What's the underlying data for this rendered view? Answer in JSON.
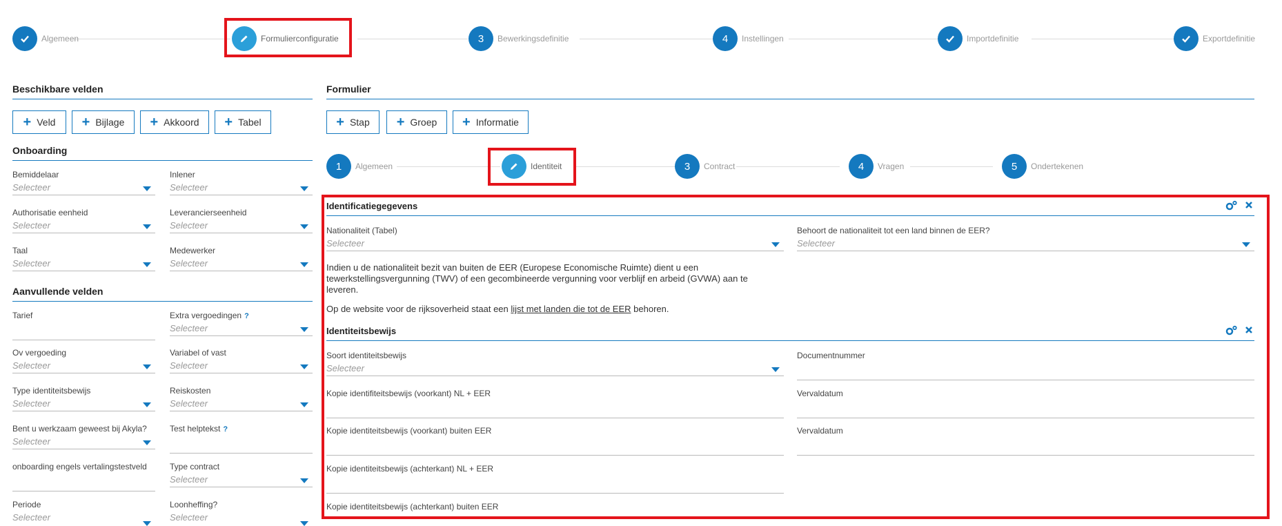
{
  "stepper": [
    {
      "number": "",
      "label": "Algemeen",
      "state": "done"
    },
    {
      "number": "",
      "label": "Formulierconfiguratie",
      "state": "active"
    },
    {
      "number": "3",
      "label": "Bewerkingsdefinitie",
      "state": "todo"
    },
    {
      "number": "4",
      "label": "Instellingen",
      "state": "todo"
    },
    {
      "number": "",
      "label": "Importdefinitie",
      "state": "done"
    },
    {
      "number": "",
      "label": "Exportdefinitie",
      "state": "done"
    }
  ],
  "left": {
    "title": "Beschikbare velden",
    "buttons": [
      "Veld",
      "Bijlage",
      "Akkoord",
      "Tabel"
    ],
    "onboarding_title": "Onboarding",
    "onboarding_fields": [
      {
        "label": "Bemiddelaar",
        "value": "Selecteer"
      },
      {
        "label": "Inlener",
        "value": "Selecteer"
      },
      {
        "label": "Authorisatie eenheid",
        "value": "Selecteer"
      },
      {
        "label": "Leverancierseenheid",
        "value": "Selecteer"
      },
      {
        "label": "Taal",
        "value": "Selecteer"
      },
      {
        "label": "Medewerker",
        "value": "Selecteer"
      }
    ],
    "extra_title": "Aanvullende velden",
    "extra_fields": [
      {
        "label": "Tarief",
        "value": ""
      },
      {
        "label": "Extra vergoedingen",
        "value": "Selecteer",
        "help": "?"
      },
      {
        "label": "Ov vergoeding",
        "value": "Selecteer"
      },
      {
        "label": "Variabel of vast",
        "value": "Selecteer"
      },
      {
        "label": "Type identiteitsbewijs",
        "value": "Selecteer"
      },
      {
        "label": "Reiskosten",
        "value": "Selecteer"
      },
      {
        "label": "Bent u werkzaam geweest bij Akyla?",
        "value": "Selecteer"
      },
      {
        "label": "Test helptekst",
        "value": "",
        "help": "?"
      },
      {
        "label": "onboarding engels vertalingstestveld",
        "value": ""
      },
      {
        "label": "Type contract",
        "value": "Selecteer"
      },
      {
        "label": "Periode",
        "value": "Selecteer"
      },
      {
        "label": "Loonheffing?",
        "value": "Selecteer"
      }
    ]
  },
  "right": {
    "title": "Formulier",
    "buttons": [
      "Stap",
      "Groep",
      "Informatie"
    ],
    "form_steps": [
      {
        "number": "1",
        "label": "Algemeen"
      },
      {
        "number": "",
        "label": "Identiteit"
      },
      {
        "number": "3",
        "label": "Contract"
      },
      {
        "number": "4",
        "label": "Vragen"
      },
      {
        "number": "5",
        "label": "Ondertekenen"
      }
    ],
    "group1": {
      "title": "Identificatiegegevens",
      "fields": [
        {
          "label": "Nationaliteit (Tabel)",
          "value": "Selecteer"
        },
        {
          "label": "Behoort de nationaliteit tot een land binnen de EER?",
          "value": "Selecteer"
        }
      ],
      "info_line1": "Indien u de nationaliteit bezit van buiten de EER (Europese Economische Ruimte) dient u een",
      "info_line2": "tewerkstellingsvergunning (TWV) of een gecombineerde vergunning voor verblijf en arbeid (GVWA) aan te",
      "info_line3": "leveren.",
      "info2_pre": "Op de website voor de rijksoverheid staat een ",
      "info2_link": "lijst met landen die tot de EER",
      "info2_post": " behoren."
    },
    "group2": {
      "title": "Identiteitsbewijs",
      "fields": [
        {
          "label": "Soort identiteitsbewijs",
          "value": "Selecteer"
        },
        {
          "label": "Documentnummer",
          "value": ""
        },
        {
          "label": "Kopie identifiteitsbewijs (voorkant) NL + EER",
          "value": ""
        },
        {
          "label": "Vervaldatum",
          "value": ""
        },
        {
          "label": "Kopie identiteitsbewijs (voorkant) buiten EER",
          "value": ""
        },
        {
          "label": "Vervaldatum",
          "value": ""
        },
        {
          "label": "Kopie identiteitsbewijs (achterkant) NL + EER",
          "value": ""
        },
        {
          "label": "Kopie identiteitsbewijs (achterkant) buiten EER",
          "value": ""
        }
      ]
    }
  },
  "colors": {
    "primary": "#1479bf",
    "active": "#2b9fd9",
    "highlight": "#e4141b"
  }
}
